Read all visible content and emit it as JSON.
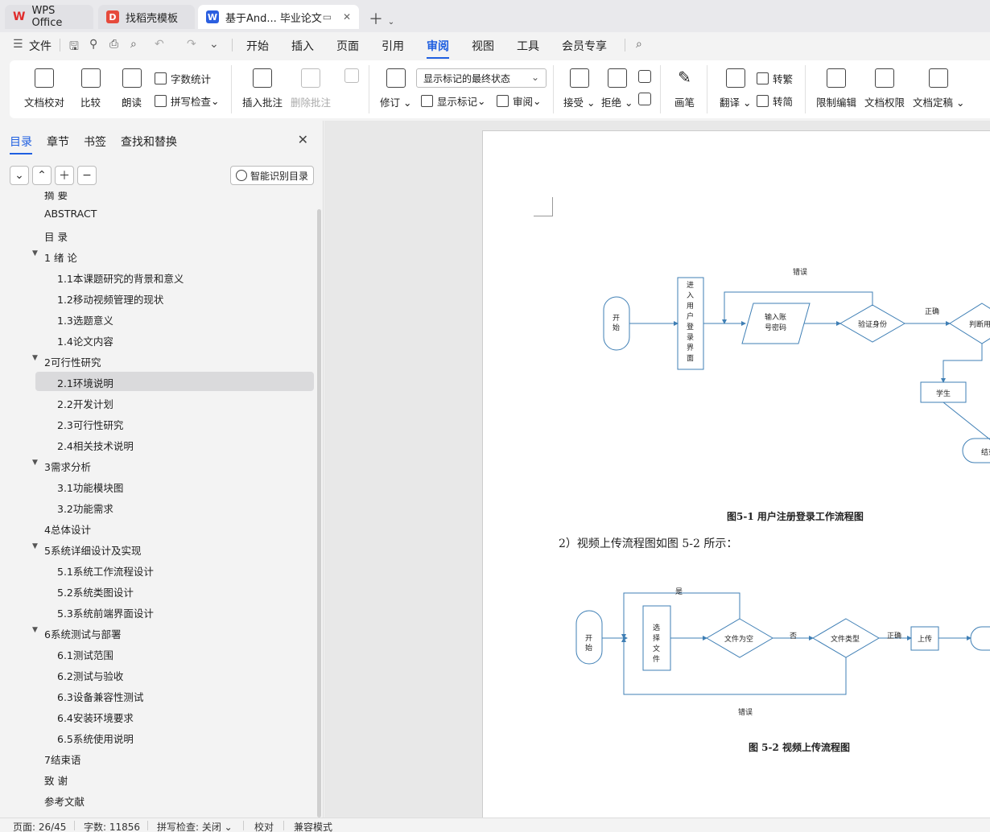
{
  "tabs": [
    {
      "label": "WPS Office"
    },
    {
      "label": "找稻壳模板"
    },
    {
      "label": "基于And... 毕业论文"
    }
  ],
  "menu": {
    "file": "文件",
    "items": [
      "开始",
      "插入",
      "页面",
      "引用",
      "审阅",
      "视图",
      "工具",
      "会员专享"
    ],
    "active": "审阅"
  },
  "ribbon": {
    "doc_check": "文档校对",
    "compare": "比较",
    "read": "朗读",
    "word_count": "字数统计",
    "spell_check": "拼写检查",
    "insert_comment": "插入批注",
    "delete_comment": "删除批注",
    "revise": "修订",
    "markup_state": "显示标记的最终状态",
    "show_markup": "显示标记",
    "review": "审阅",
    "accept": "接受",
    "reject": "拒绝",
    "pen": "画笔",
    "translate": "翻译",
    "to_traditional": "转繁",
    "to_simplified": "转简",
    "restrict_edit": "限制编辑",
    "doc_permission": "文档权限",
    "doc_finalize": "文档定稿"
  },
  "sidebar": {
    "tabs": [
      "目录",
      "章节",
      "书签",
      "查找和替换"
    ],
    "smart_toc": "智能识别目录",
    "toc": [
      {
        "label": "摘 要",
        "level": 0
      },
      {
        "label": "ABSTRACT",
        "level": 0
      },
      {
        "label": "目 录",
        "level": 0
      },
      {
        "label": "1 绪 论",
        "level": 0,
        "expanded": true
      },
      {
        "label": "1.1本课题研究的背景和意义",
        "level": 1
      },
      {
        "label": "1.2移动视频管理的现状",
        "level": 1
      },
      {
        "label": "1.3选题意义",
        "level": 1
      },
      {
        "label": "1.4论文内容",
        "level": 1
      },
      {
        "label": "2可行性研究",
        "level": 0,
        "expanded": true
      },
      {
        "label": "2.1环境说明",
        "level": 1,
        "selected": true
      },
      {
        "label": "2.2开发计划",
        "level": 1
      },
      {
        "label": "2.3可行性研究",
        "level": 1
      },
      {
        "label": "2.4相关技术说明",
        "level": 1
      },
      {
        "label": "3需求分析",
        "level": 0,
        "expanded": true
      },
      {
        "label": "3.1功能模块图",
        "level": 1
      },
      {
        "label": "3.2功能需求",
        "level": 1
      },
      {
        "label": "4总体设计",
        "level": 0
      },
      {
        "label": "5系统详细设计及实现",
        "level": 0,
        "expanded": true
      },
      {
        "label": "5.1系统工作流程设计",
        "level": 1
      },
      {
        "label": "5.2系统类图设计",
        "level": 1
      },
      {
        "label": "5.3系统前端界面设计",
        "level": 1
      },
      {
        "label": "6系统测试与部署",
        "level": 0,
        "expanded": true
      },
      {
        "label": "6.1测试范围",
        "level": 1
      },
      {
        "label": "6.2测试与验收",
        "level": 1
      },
      {
        "label": "6.3设备兼容性测试",
        "level": 1
      },
      {
        "label": "6.4安装环境要求",
        "level": 1
      },
      {
        "label": "6.5系统使用说明",
        "level": 1
      },
      {
        "label": "7结束语",
        "level": 0
      },
      {
        "label": "致 谢",
        "level": 0
      },
      {
        "label": "参考文献",
        "level": 0
      }
    ]
  },
  "document": {
    "fig1": {
      "caption": "图5-1   用户注册登录工作流程图",
      "start": [
        "开",
        "始"
      ],
      "login": [
        "进",
        "入",
        "用",
        "户",
        "登",
        "录",
        "界",
        "面"
      ],
      "input": [
        "输入账",
        "号密码"
      ],
      "verify": "验证身份",
      "error": "错误",
      "correct": "正确",
      "judge": "判断用户",
      "student": "学生",
      "end": "结束"
    },
    "paragraph": "2）视频上传流程图如图 5-2 所示：",
    "fig2": {
      "caption": "图 5-2   视频上传流程图",
      "start": [
        "开",
        "始"
      ],
      "select": [
        "选",
        "择",
        "文",
        "件"
      ],
      "empty": "文件为空",
      "type": "文件类型",
      "upload": "上传",
      "yes": "是",
      "no": "否",
      "correct": "正确",
      "error": "错误"
    }
  },
  "status": {
    "page": "页面: 26/45",
    "words": "字数: 11856",
    "spell": "拼写检查: 关闭",
    "proof": "校对",
    "compat": "兼容模式"
  }
}
